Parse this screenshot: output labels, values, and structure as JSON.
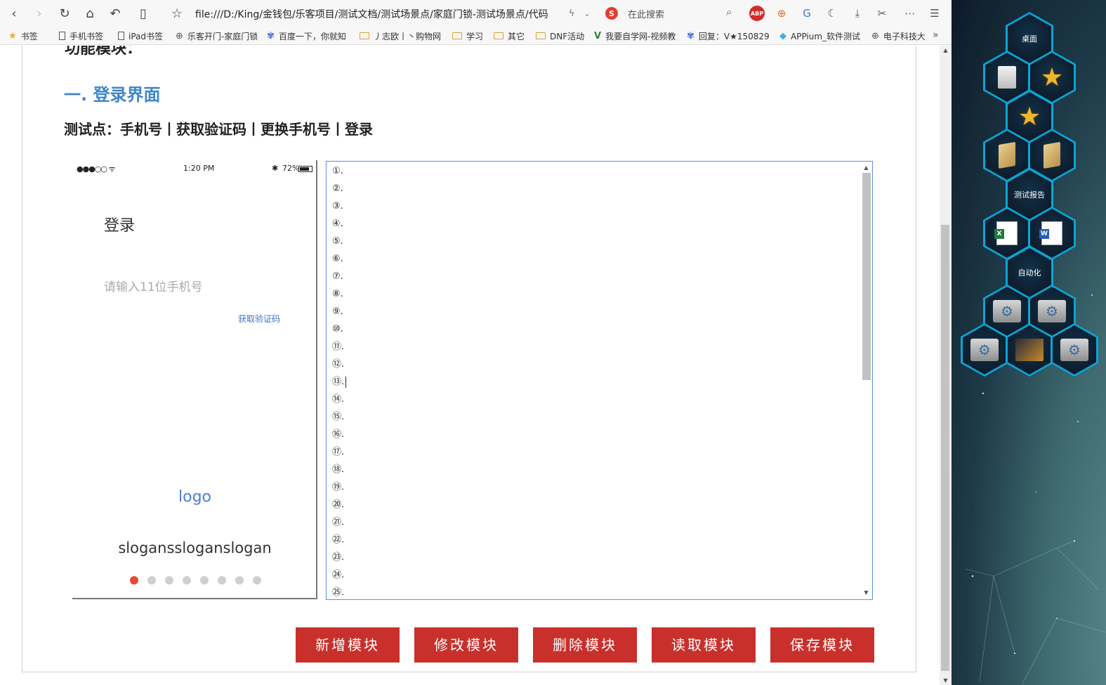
{
  "browser": {
    "url": "file:///D:/King/金钱包/乐客项目/测试文档/测试场景点/家庭门锁-测试场景点/代码",
    "search_placeholder": "在此搜索",
    "search_engine_letter": "S",
    "abp_label": "ABP",
    "icons": [
      "back-icon",
      "forward-icon",
      "reload-icon",
      "home-icon",
      "undo-icon",
      "reader-icon",
      "bookmark-star-icon",
      "lightning-icon",
      "search-icon",
      "adblock-icon",
      "game-icon",
      "translate-icon",
      "night-mode-icon",
      "download-icon",
      "scissors-icon",
      "more-icon",
      "menu-icon"
    ]
  },
  "bookmarks": [
    {
      "label": "书签",
      "type": "star"
    },
    {
      "label": "手机书签",
      "type": "page"
    },
    {
      "label": "iPad书签",
      "type": "page"
    },
    {
      "label": "乐客开门-家庭门锁",
      "type": "globe"
    },
    {
      "label": "百度一下，你就知",
      "type": "paw"
    },
    {
      "label": "丿志欧丨丶购物网",
      "type": "folder"
    },
    {
      "label": "学习",
      "type": "folder"
    },
    {
      "label": "其它",
      "type": "folder"
    },
    {
      "label": "DNF活动",
      "type": "folder"
    },
    {
      "label": "我要自学网-视频教",
      "type": "v"
    },
    {
      "label": "回复：V★150829",
      "type": "paw"
    },
    {
      "label": "APPium_软件测试",
      "type": "diamond"
    },
    {
      "label": "电子科技大",
      "type": "globe"
    }
  ],
  "page": {
    "cut_heading": "功能模块：",
    "section_title": "一. 登录界面",
    "test_points": "测试点：手机号丨获取验证码丨更换手机号丨登录"
  },
  "phone": {
    "status_signal": "●●●○○ ᯤ",
    "status_time": "1:20 PM",
    "status_bt": "✱",
    "status_battery": "72%",
    "title": "登录",
    "phone_placeholder": "请输入11位手机号",
    "get_code": "获取验证码",
    "logo": "logo",
    "slogan": "sloganssloganslogan",
    "dot_count": 8,
    "active_dot": 0
  },
  "editor": {
    "lines": [
      "①.",
      "②.",
      "③.",
      "④.",
      "⑤.",
      "⑥.",
      "⑦.",
      "⑧.",
      "⑨.",
      "⑩.",
      "⑪.",
      "⑫.",
      "⑬.",
      "⑭.",
      "⑮.",
      "⑯.",
      "⑰.",
      "⑱.",
      "⑲.",
      "⑳.",
      "㉑.",
      "㉒.",
      "㉓.",
      "㉔.",
      "㉕."
    ],
    "caret_line": 12
  },
  "buttons": {
    "add": "新增模块",
    "edit": "修改模块",
    "delete": "删除模块",
    "read": "读取模块",
    "save": "保存模块"
  },
  "colors": {
    "section_blue": "#3f86c8",
    "button_red": "#c9302c",
    "active_dot": "#e64a3b",
    "hex_border": "#0aa5d6"
  },
  "desktop": {
    "labels": {
      "desktop": "桌面",
      "test_report": "测试报告",
      "automation": "自动化"
    }
  }
}
